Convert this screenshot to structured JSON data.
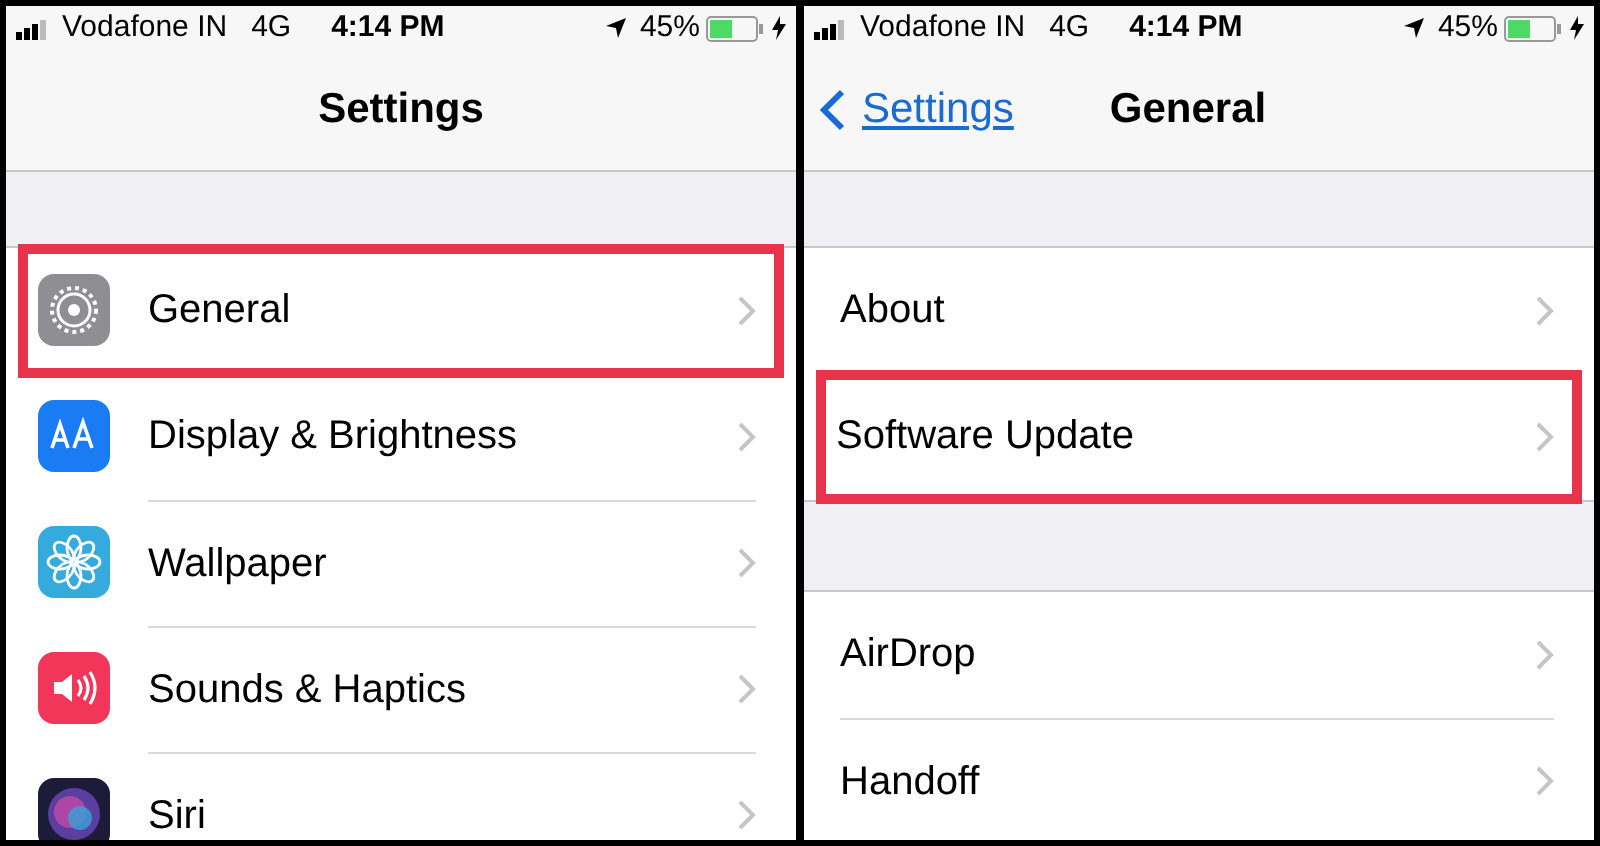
{
  "panels": [
    {
      "status_bar": {
        "carrier": "Vodafone IN",
        "network": "4G",
        "time": "4:14 PM",
        "battery": "45%"
      },
      "nav": {
        "title": "Settings"
      },
      "groups": [
        {
          "rows": [
            {
              "label": "General",
              "highlighted": true
            },
            {
              "label": "Display & Brightness",
              "highlighted": false
            },
            {
              "label": "Wallpaper",
              "highlighted": false
            },
            {
              "label": "Sounds & Haptics",
              "highlighted": false
            },
            {
              "label": "Siri",
              "highlighted": false
            }
          ]
        }
      ]
    },
    {
      "status_bar": {
        "carrier": "Vodafone IN",
        "network": "4G",
        "time": "4:14 PM",
        "battery": "45%"
      },
      "nav": {
        "back": "Settings",
        "title": "General"
      },
      "groups": [
        {
          "rows": [
            {
              "label": "About",
              "highlighted": false
            },
            {
              "label": "Software Update",
              "highlighted": true
            }
          ]
        },
        {
          "rows": [
            {
              "label": "AirDrop",
              "highlighted": false
            },
            {
              "label": "Handoff",
              "highlighted": false
            }
          ]
        }
      ]
    }
  ]
}
